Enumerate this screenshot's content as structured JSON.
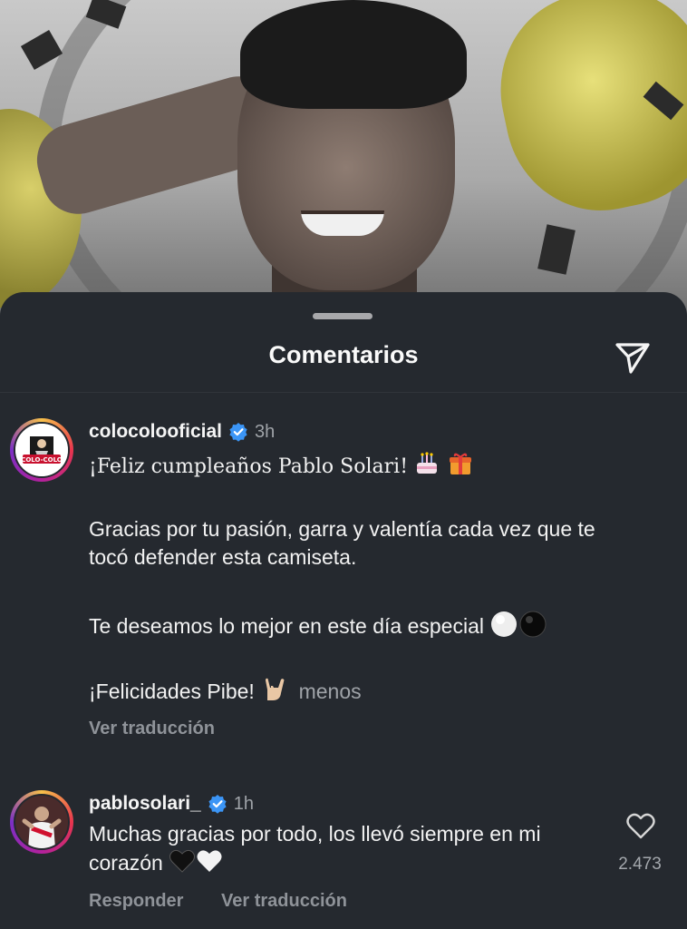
{
  "sheet": {
    "title": "Comentarios"
  },
  "comments": [
    {
      "username": "colocolooficial",
      "time": "3h",
      "avatar_text": "COLO-COLO",
      "line1": "¡Feliz cumpleaños Pablo Solari!",
      "line2": "Gracias por tu pasión, garra y valentía cada vez que te tocó defender esta camiseta.",
      "line3": "Te deseamos lo mejor en este día especial",
      "line4": "¡Felicidades Pibe!",
      "less_label": "menos",
      "translate_label": "Ver traducción"
    },
    {
      "username": "pablosolari_",
      "time": "1h",
      "text": "Muchas gracias por todo, los llevó siempre en mi corazón",
      "reply_label": "Responder",
      "translate_label": "Ver traducción",
      "likes": "2.473"
    }
  ],
  "icons": {
    "send": "paper-plane-icon",
    "verified": "verified-badge-icon",
    "like": "heart-outline-icon"
  },
  "colors": {
    "sheet_bg": "#25292f",
    "verified": "#3b95f6",
    "muted": "#9fa3a8"
  }
}
